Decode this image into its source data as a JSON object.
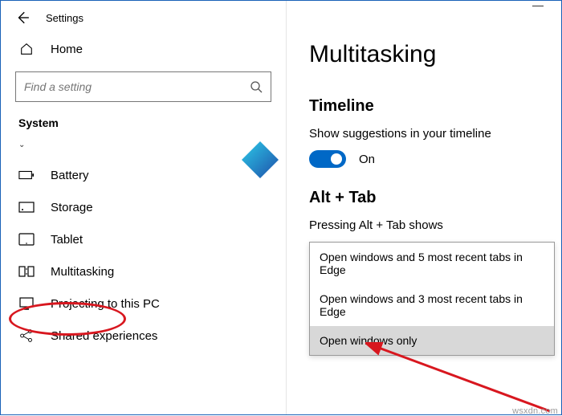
{
  "window": {
    "title": "Settings"
  },
  "sidebar": {
    "home_label": "Home",
    "search_placeholder": "Find a setting",
    "section_label": "System",
    "items": [
      {
        "label": "Battery",
        "icon": "battery-icon"
      },
      {
        "label": "Storage",
        "icon": "storage-icon"
      },
      {
        "label": "Tablet",
        "icon": "tablet-icon"
      },
      {
        "label": "Multitasking",
        "icon": "multitasking-icon"
      },
      {
        "label": "Projecting to this PC",
        "icon": "projecting-icon"
      },
      {
        "label": "Shared experiences",
        "icon": "shared-icon"
      }
    ]
  },
  "main": {
    "page_title": "Multitasking",
    "timeline": {
      "heading": "Timeline",
      "desc": "Show suggestions in your timeline",
      "toggle_label": "On",
      "toggle_state": true
    },
    "alttab": {
      "heading": "Alt + Tab",
      "desc": "Pressing Alt + Tab shows",
      "options": [
        "Open windows and 5 most recent tabs in Edge",
        "Open windows and 3 most recent tabs in Edge",
        "Open windows only"
      ],
      "selected_index": 2
    }
  },
  "watermark": "wsxdn.com",
  "colors": {
    "accent": "#0068c6",
    "highlight": "#d8171f",
    "border": "#1a62b8"
  }
}
